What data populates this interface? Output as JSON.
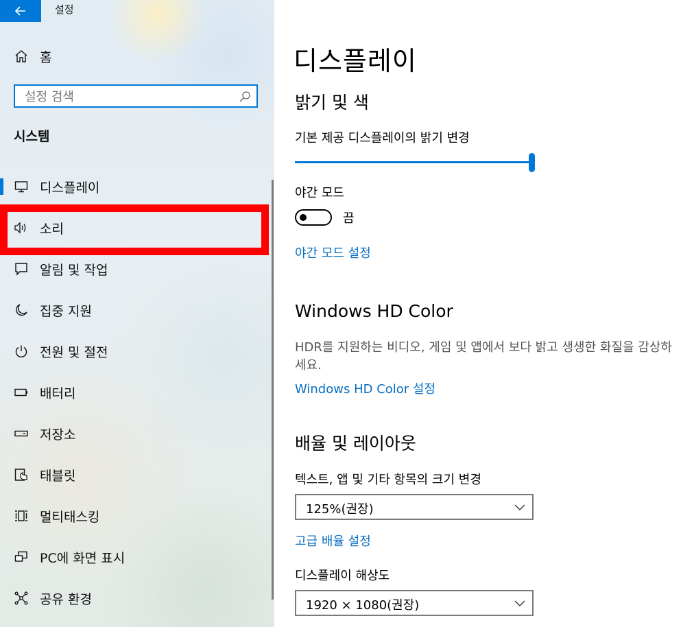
{
  "window": {
    "title": "설정"
  },
  "sidebar": {
    "home_label": "홈",
    "search": {
      "placeholder": "설정 검색",
      "value": ""
    },
    "section_title": "시스템",
    "items": [
      {
        "label": "디스플레이",
        "icon": "monitor-icon",
        "active": true
      },
      {
        "label": "소리",
        "icon": "speaker-icon",
        "highlighted": true
      },
      {
        "label": "알림 및 작업",
        "icon": "message-icon"
      },
      {
        "label": "집중 지원",
        "icon": "moon-icon"
      },
      {
        "label": "전원 및 절전",
        "icon": "power-icon"
      },
      {
        "label": "배터리",
        "icon": "battery-icon"
      },
      {
        "label": "저장소",
        "icon": "storage-icon"
      },
      {
        "label": "태블릿",
        "icon": "tablet-icon"
      },
      {
        "label": "멀티태스킹",
        "icon": "multitasking-icon"
      },
      {
        "label": "PC에 화면 표시",
        "icon": "project-icon"
      },
      {
        "label": "공유 환경",
        "icon": "share-icon"
      }
    ]
  },
  "main": {
    "title": "디스플레이",
    "brightness": {
      "heading": "밝기 및 색",
      "slider_label": "기본 제공 디스플레이의 밝기 변경",
      "slider_value": 1.0,
      "night_light_label": "야간 모드",
      "night_light_state": "끔",
      "night_light_on": false,
      "night_light_link": "야간 모드 설정"
    },
    "hdr": {
      "heading": "Windows HD Color",
      "description": "HDR를 지원하는 비디오, 게임 및 앱에서 보다 밝고 생생한 화질을 감상하세요.",
      "link": "Windows HD Color 설정"
    },
    "scale": {
      "heading": "배율 및 레이아웃",
      "scale_label": "텍스트, 앱 및 기타 항목의 크기 변경",
      "scale_value": "125%(권장)",
      "advanced_link": "고급 배율 설정",
      "resolution_label": "디스플레이 해상도",
      "resolution_value": "1920 × 1080(권장)"
    }
  },
  "colors": {
    "accent": "#0078d7",
    "link": "#0a6fc1",
    "highlight": "#ff0000"
  }
}
